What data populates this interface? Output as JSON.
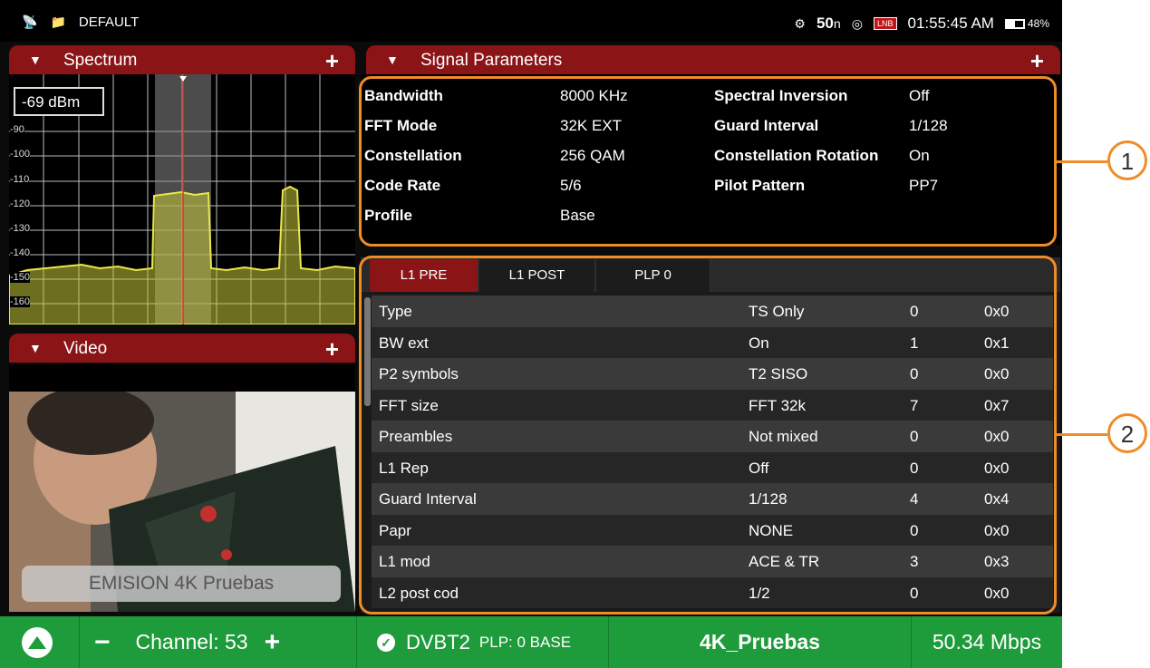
{
  "status_bar": {
    "folder_label": "DEFAULT",
    "reading": "50",
    "reading_unit": "n",
    "rec_badge": "LNB",
    "time": "01:55:45 AM",
    "battery_percent": "48%",
    "battery_level": 0.48
  },
  "spectrum": {
    "title": "Spectrum",
    "level_readout": "-69 dBm",
    "axis_ticks": [
      "-90",
      "-100",
      "-110",
      "-120",
      "-130",
      "-140",
      "-150",
      "-160"
    ],
    "accent": "#e2e24a"
  },
  "video": {
    "title": "Video",
    "caption": "EMISION 4K Pruebas"
  },
  "signal_parameters": {
    "title": "Signal Parameters",
    "rows": [
      {
        "label1": "Bandwidth",
        "value1": "8000 KHz",
        "label2": "Spectral Inversion",
        "value2": "Off"
      },
      {
        "label1": "FFT Mode",
        "value1": "32K EXT",
        "label2": "Guard Interval",
        "value2": "1/128"
      },
      {
        "label1": "Constellation",
        "value1": "256 QAM",
        "label2": "Constellation Rotation",
        "value2": "On"
      },
      {
        "label1": "Code Rate",
        "value1": "5/6",
        "label2": "Pilot Pattern",
        "value2": "PP7"
      },
      {
        "label1": "Profile",
        "value1": "Base",
        "label2": "",
        "value2": ""
      }
    ]
  },
  "l1_table": {
    "tabs": [
      "L1 PRE",
      "L1 POST",
      "PLP 0"
    ],
    "active_tab": 0,
    "rows": [
      {
        "name": "Type",
        "value": "TS Only",
        "num": "0",
        "hex": "0x0"
      },
      {
        "name": "BW ext",
        "value": "On",
        "num": "1",
        "hex": "0x1"
      },
      {
        "name": "P2 symbols",
        "value": "T2 SISO",
        "num": "0",
        "hex": "0x0"
      },
      {
        "name": "FFT size",
        "value": "FFT 32k",
        "num": "7",
        "hex": "0x7"
      },
      {
        "name": "Preambles",
        "value": "Not mixed",
        "num": "0",
        "hex": "0x0"
      },
      {
        "name": "L1 Rep",
        "value": "Off",
        "num": "0",
        "hex": "0x0"
      },
      {
        "name": "Guard Interval",
        "value": "1/128",
        "num": "4",
        "hex": "0x4"
      },
      {
        "name": "Papr",
        "value": "NONE",
        "num": "0",
        "hex": "0x0"
      },
      {
        "name": "L1 mod",
        "value": "ACE & TR",
        "num": "3",
        "hex": "0x3"
      },
      {
        "name": "L2 post cod",
        "value": "1/2",
        "num": "0",
        "hex": "0x0"
      }
    ]
  },
  "callouts": [
    "1",
    "2"
  ],
  "bottom_bar": {
    "channel_label": "Channel: 53",
    "standard": "DVBT2",
    "plp": "PLP: 0 BASE",
    "service": "4K_Pruebas",
    "bitrate": "50.34 Mbps"
  },
  "colors": {
    "header_red": "#8a1416",
    "callout_orange": "#f08c28",
    "bottom_green": "#1e9b3a"
  }
}
